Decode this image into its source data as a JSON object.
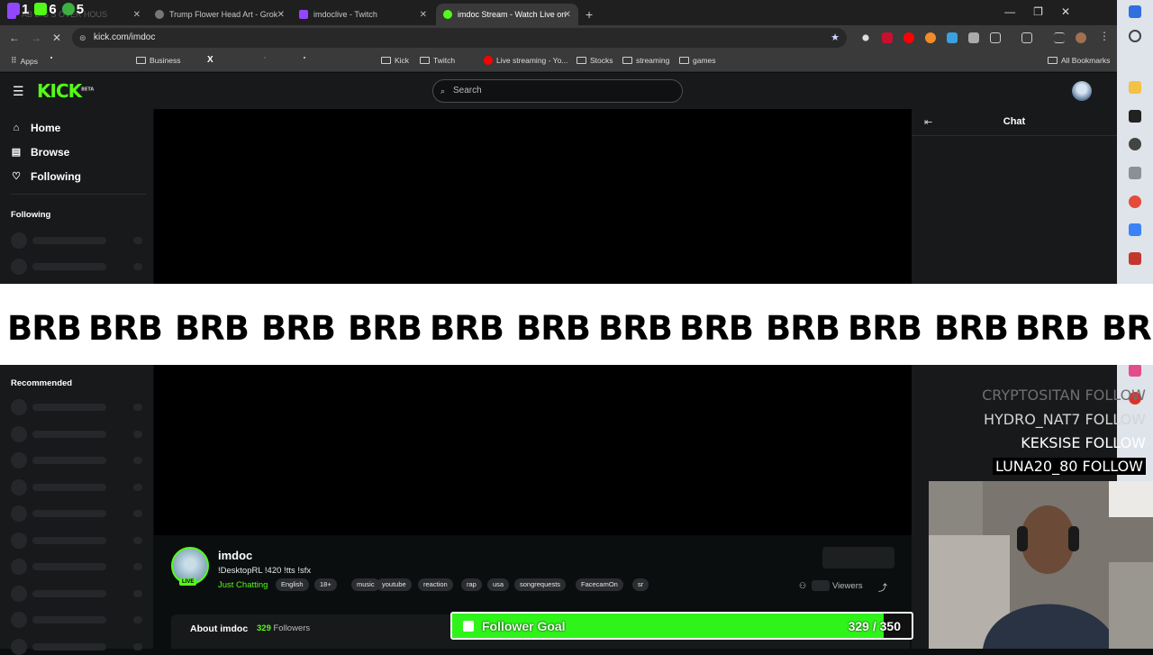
{
  "browser": {
    "overlay_counters": [
      "1",
      "6",
      "5"
    ],
    "tabs": [
      {
        "title": "AB BIG S OVER HOUS",
        "active": false,
        "color": "#9146ff"
      },
      {
        "title": "Trump Flower Head Art - Grok",
        "active": false,
        "color": "#cccccc"
      },
      {
        "title": "imdoclive - Twitch",
        "active": false,
        "color": "#9146ff"
      },
      {
        "title": "imdoc Stream - Watch Live on",
        "active": true,
        "color": "#53fc18"
      }
    ],
    "url": "kick.com/imdoc",
    "bookmarks": [
      {
        "label": "Apps",
        "type": "apps"
      },
      {
        "label": "Business",
        "type": "folder"
      },
      {
        "label": "Kick",
        "type": "folder"
      },
      {
        "label": "Twitch",
        "type": "folder"
      },
      {
        "label": "Live streaming - Yo...",
        "type": "link"
      },
      {
        "label": "Stocks",
        "type": "folder"
      },
      {
        "label": "streaming",
        "type": "folder"
      },
      {
        "label": "games",
        "type": "folder"
      },
      {
        "label": "All Bookmarks",
        "type": "folder"
      }
    ]
  },
  "kick": {
    "logo": "KICK",
    "logo_badge": "BETA",
    "search_placeholder": "Search",
    "nav": [
      {
        "label": "Home",
        "icon": "home-icon"
      },
      {
        "label": "Browse",
        "icon": "browse-icon"
      },
      {
        "label": "Following",
        "icon": "heart-icon"
      }
    ],
    "following_heading": "Following",
    "recommended_heading": "Recommended",
    "chat_title": "Chat"
  },
  "stream_overlay": {
    "brb_text": [
      "BRB",
      "BRB",
      "BRB",
      "BRB",
      "BRB",
      "BRB",
      "BRB",
      "BRB",
      "BRB",
      "BRB",
      "BRB",
      "BRB",
      "BRB",
      "BRB"
    ],
    "follow_alerts": [
      {
        "name": "CRYPTOSITAN",
        "action": "FOLLOW"
      },
      {
        "name": "HYDRO_NAT7",
        "action": "FOLLOW"
      },
      {
        "name": "KEKSISE",
        "action": "FOLLOW"
      },
      {
        "name": "LUNA20_80",
        "action": "FOLLOW"
      }
    ],
    "follower_goal": {
      "label": "Follower Goal",
      "count_text": "329 / 350",
      "current": 329,
      "target": 350
    }
  },
  "channel": {
    "name": "imdoc",
    "live_badge": "LIVE",
    "title": "!DesktopRL !420 !tts !sfx",
    "category": "Just Chatting",
    "tags": [
      "English",
      "18+",
      "music",
      "youtube",
      "reaction",
      "rap",
      "usa",
      "songrequests",
      "FacecamOn",
      "sr"
    ],
    "viewers_label": "Viewers",
    "about_label": "About imdoc",
    "followers_count": "329",
    "followers_label": "Followers"
  }
}
